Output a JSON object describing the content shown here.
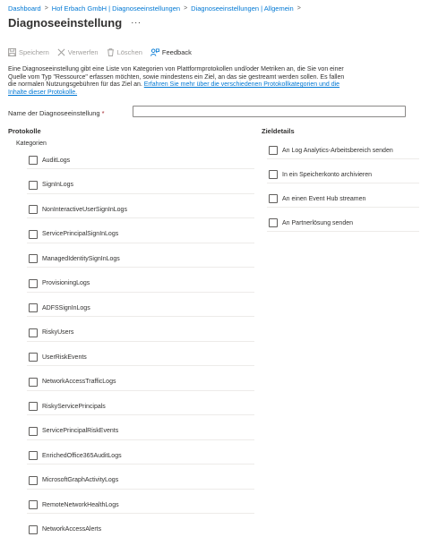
{
  "breadcrumb": {
    "items": [
      "Dashboard",
      "Hof Erbach GmbH | Diagnoseeinstellungen",
      "Diagnoseeinstellungen | Allgemein"
    ]
  },
  "page": {
    "title": "Diagnoseeinstellung",
    "more": "···"
  },
  "toolbar": {
    "save_label": "Speichern",
    "discard_label": "Verwerfen",
    "delete_label": "Löschen",
    "feedback_label": "Feedback"
  },
  "description": {
    "text": "Eine Diagnoseeinstellung gibt eine Liste von Kategorien von Plattformprotokollen und/oder Metriken an, die Sie von einer Quelle vom Typ \"Ressource\" erfassen möchten, sowie mindestens ein Ziel, an das sie gestreamt werden sollen. Es fallen die normalen Nutzungsgebühren für das Ziel an. ",
    "link": "Erfahren Sie mehr über die verschiedenen Protokollkategorien und die Inhalte dieser Protokolle."
  },
  "name_field": {
    "label": "Name der Diagnoseeinstellung",
    "required_mark": "*",
    "value": "",
    "placeholder": ""
  },
  "logs": {
    "heading": "Protokolle",
    "categories_label": "Kategorien",
    "items": [
      {
        "label": "AuditLogs",
        "checked": false
      },
      {
        "label": "SignInLogs",
        "checked": false
      },
      {
        "label": "NonInteractiveUserSignInLogs",
        "checked": false
      },
      {
        "label": "ServicePrincipalSignInLogs",
        "checked": false
      },
      {
        "label": "ManagedIdentitySignInLogs",
        "checked": false
      },
      {
        "label": "ProvisioningLogs",
        "checked": false
      },
      {
        "label": "ADFSSignInLogs",
        "checked": false
      },
      {
        "label": "RiskyUsers",
        "checked": false
      },
      {
        "label": "UserRiskEvents",
        "checked": false
      },
      {
        "label": "NetworkAccessTrafficLogs",
        "checked": false
      },
      {
        "label": "RiskyServicePrincipals",
        "checked": false
      },
      {
        "label": "ServicePrincipalRiskEvents",
        "checked": false
      },
      {
        "label": "EnrichedOffice365AuditLogs",
        "checked": false
      },
      {
        "label": "MicrosoftGraphActivityLogs",
        "checked": false
      },
      {
        "label": "RemoteNetworkHealthLogs",
        "checked": false
      },
      {
        "label": "NetworkAccessAlerts",
        "checked": false
      }
    ]
  },
  "destinations": {
    "heading": "Zieldetails",
    "items": [
      {
        "label": "An Log Analytics-Arbeitsbereich senden",
        "checked": false
      },
      {
        "label": "In ein Speicherkonto archivieren",
        "checked": false
      },
      {
        "label": "An einen Event Hub streamen",
        "checked": false
      },
      {
        "label": "An Partnerlösung senden",
        "checked": false
      }
    ]
  },
  "colors": {
    "link": "#0078d4",
    "text": "#323130",
    "disabled": "#a19f9d",
    "divider": "#edebe9"
  }
}
